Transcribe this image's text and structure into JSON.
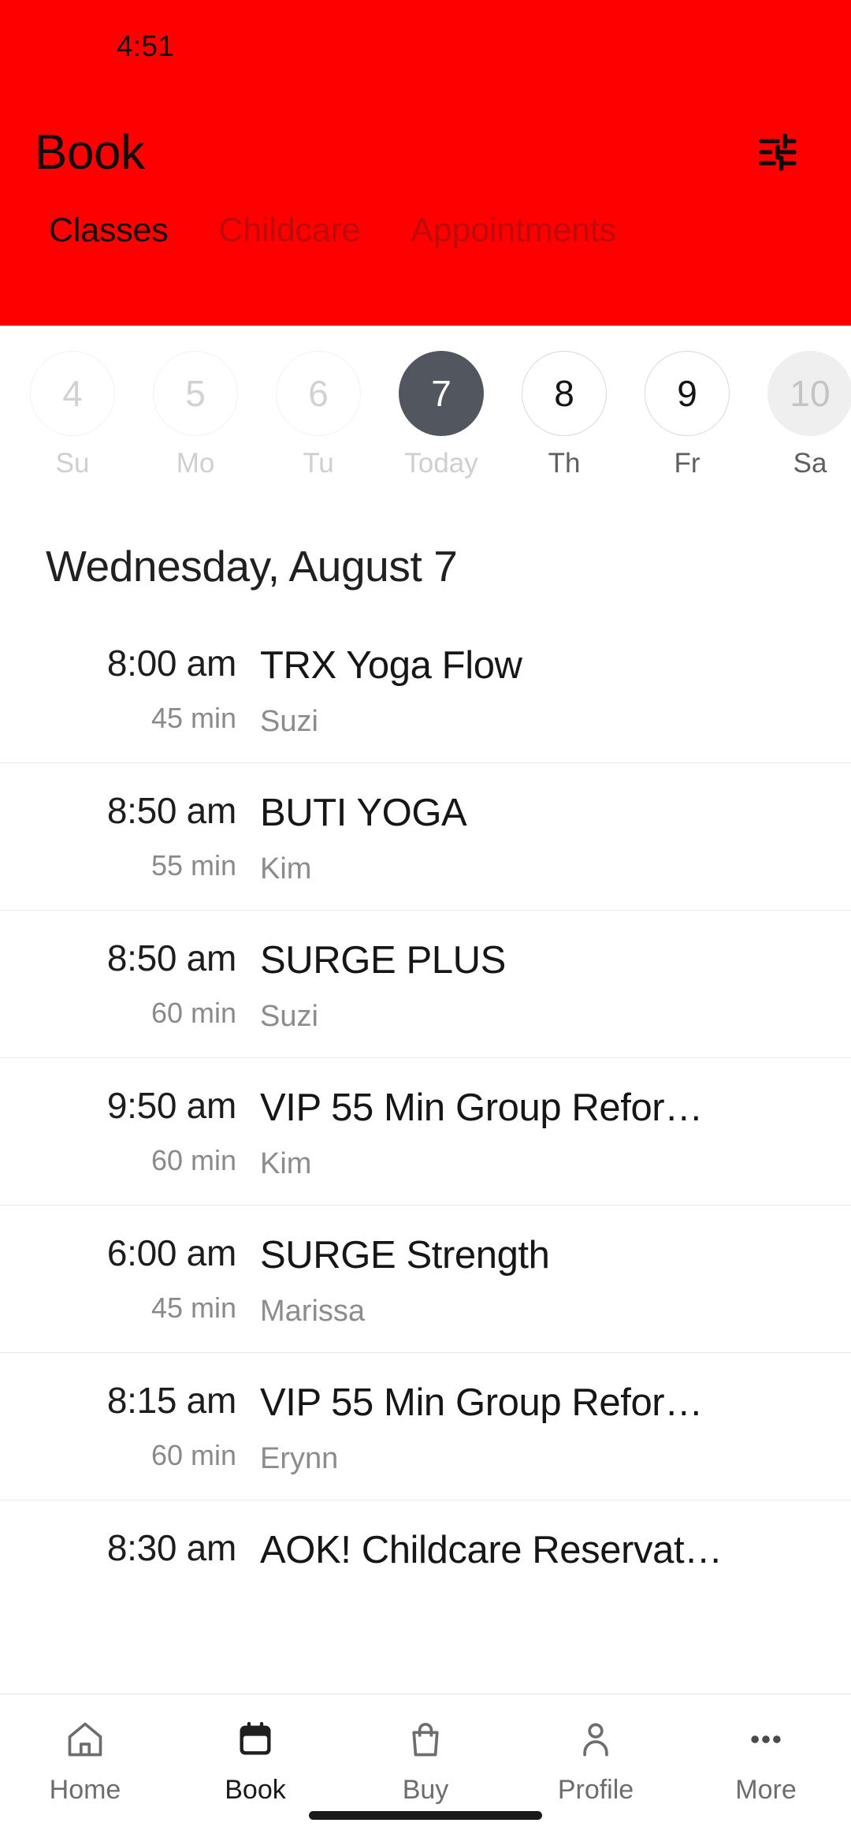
{
  "status_bar": {
    "time": "4:51"
  },
  "header": {
    "title": "Book",
    "background_color": "#fe0000",
    "filter_icon": "sliders-filter-icon",
    "tabs": [
      {
        "label": "Classes",
        "active": true
      },
      {
        "label": "Childcare",
        "active": false
      },
      {
        "label": "Appointments",
        "active": false
      }
    ]
  },
  "date_strip": {
    "days": [
      {
        "number": "4",
        "label": "Su",
        "state": "past"
      },
      {
        "number": "5",
        "label": "Mo",
        "state": "past"
      },
      {
        "number": "6",
        "label": "Tu",
        "state": "past"
      },
      {
        "number": "7",
        "label": "Today",
        "state": "today"
      },
      {
        "number": "8",
        "label": "Th",
        "state": "future"
      },
      {
        "number": "9",
        "label": "Fr",
        "state": "future"
      },
      {
        "number": "10",
        "label": "Sa",
        "state": "filled"
      }
    ],
    "selected_color": "#52565e"
  },
  "schedule": {
    "date_heading": "Wednesday, August 7",
    "classes": [
      {
        "time": "8:00 am",
        "duration": "45 min",
        "name": "TRX Yoga Flow",
        "instructor": "Suzi"
      },
      {
        "time": "8:50 am",
        "duration": "55 min",
        "name": "BUTI YOGA",
        "instructor": "Kim"
      },
      {
        "time": "8:50 am",
        "duration": "60 min",
        "name": "SURGE PLUS",
        "instructor": "Suzi"
      },
      {
        "time": "9:50 am",
        "duration": "60 min",
        "name": "VIP 55 Min Group Refor…",
        "instructor": "Kim"
      },
      {
        "time": "6:00 am",
        "duration": "45 min",
        "name": "SURGE Strength",
        "instructor": "Marissa"
      },
      {
        "time": "8:15 am",
        "duration": "60 min",
        "name": "VIP 55 Min Group Refor…",
        "instructor": "Erynn"
      },
      {
        "time": "8:30 am",
        "duration": "",
        "name": "AOK! Childcare Reservat…",
        "instructor": ""
      }
    ]
  },
  "bottom_nav": {
    "items": [
      {
        "label": "Home",
        "icon": "house-icon",
        "active": false
      },
      {
        "label": "Book",
        "icon": "calendar-icon",
        "active": true
      },
      {
        "label": "Buy",
        "icon": "shopping-bag-icon",
        "active": false
      },
      {
        "label": "Profile",
        "icon": "person-icon",
        "active": false
      },
      {
        "label": "More",
        "icon": "ellipsis-icon",
        "active": false
      }
    ]
  }
}
